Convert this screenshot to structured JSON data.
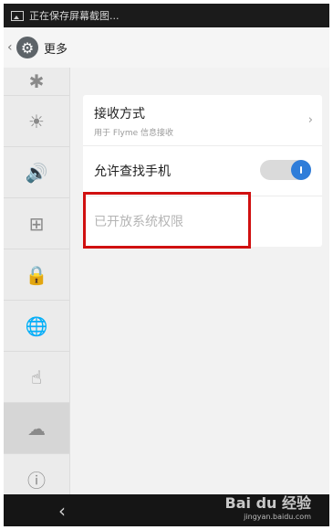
{
  "status_bar": {
    "text": "正在保存屏幕截图..."
  },
  "header": {
    "title": "更多"
  },
  "sidebar": {
    "items": [
      {
        "icon": "bluetooth-icon",
        "glyph": "✱"
      },
      {
        "icon": "brightness-icon",
        "glyph": "☀"
      },
      {
        "icon": "volume-icon",
        "glyph": "🔊"
      },
      {
        "icon": "apps-grid-icon",
        "glyph": "⊞"
      },
      {
        "icon": "location-lock-icon",
        "glyph": "🔒"
      },
      {
        "icon": "globe-icon",
        "glyph": "🌐"
      },
      {
        "icon": "hand-gesture-icon",
        "glyph": "☝"
      },
      {
        "icon": "cloud-location-icon",
        "glyph": "☁"
      },
      {
        "icon": "info-icon",
        "glyph": "ⓘ"
      }
    ]
  },
  "settings": {
    "receive_method_title": "接收方式",
    "receive_method_sub": "用于 Flyme 信息接收",
    "find_phone_label": "允许查找手机",
    "find_phone_enabled": true,
    "system_permission_label": "已开放系统权限"
  },
  "watermark": {
    "main": "Bai du 经验",
    "sub": "jingyan.baidu.com"
  }
}
